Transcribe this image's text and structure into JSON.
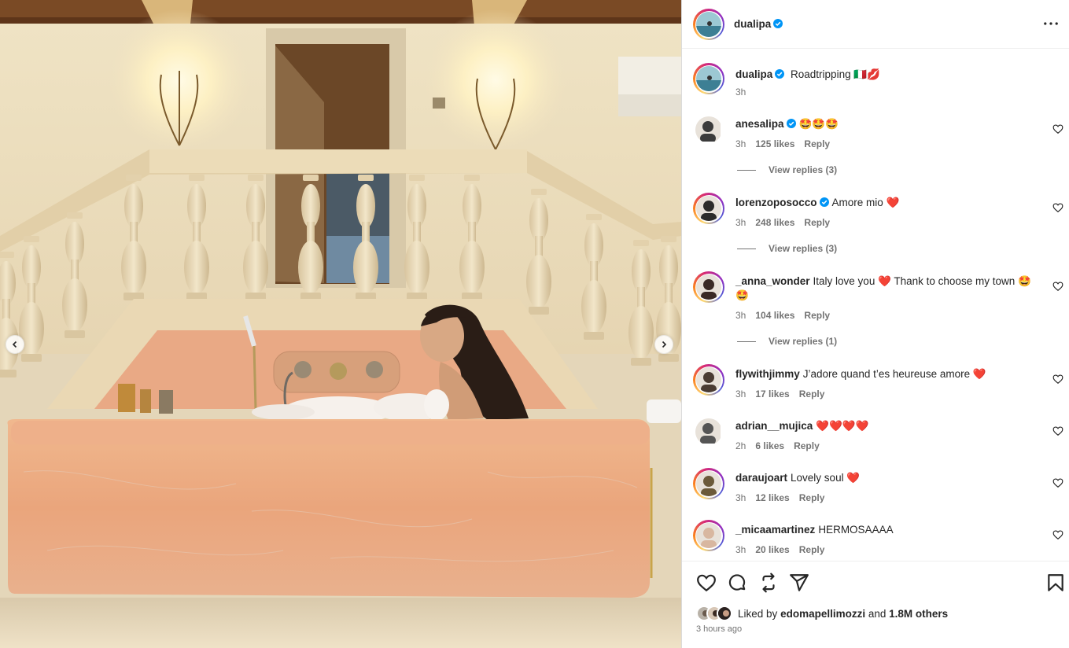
{
  "post": {
    "author": "dualipa",
    "caption_text": "Roadtripping",
    "caption_emoji": "🇮🇹💋",
    "caption_time": "3h",
    "more_icon": "more-horizontal-icon",
    "carousel": {
      "prev_icon": "chevron-left-icon",
      "next_icon": "chevron-right-icon"
    }
  },
  "comments": [
    {
      "user": "anesalipa",
      "verified": true,
      "text": "🤩🤩🤩",
      "time": "3h",
      "likes": "125 likes",
      "reply": "Reply",
      "view_replies": "View replies (3)"
    },
    {
      "user": "lorenzoposocco",
      "verified": true,
      "text": "Amore mio ❤️",
      "time": "3h",
      "likes": "248 likes",
      "reply": "Reply",
      "view_replies": "View replies (3)"
    },
    {
      "user": "_anna_wonder",
      "verified": false,
      "text": "Italy love you ❤️ Thank to choose my town 🤩 🤩",
      "time": "3h",
      "likes": "104 likes",
      "reply": "Reply",
      "view_replies": "View replies (1)"
    },
    {
      "user": "flywithjimmy",
      "verified": false,
      "text": "J’adore quand t’es heureuse amore ❤️",
      "time": "3h",
      "likes": "17 likes",
      "reply": "Reply"
    },
    {
      "user": "adrian__mujica",
      "verified": false,
      "text": "❤️❤️❤️❤️",
      "time": "2h",
      "likes": "6 likes",
      "reply": "Reply"
    },
    {
      "user": "daraujoart",
      "verified": false,
      "text": "Lovely soul ❤️",
      "time": "3h",
      "likes": "12 likes",
      "reply": "Reply"
    },
    {
      "user": "_micaamartinez",
      "verified": false,
      "text": "HERMOSAAAA",
      "time": "3h",
      "likes": "20 likes",
      "reply": "Reply"
    }
  ],
  "actions": {
    "like_icon": "heart-icon",
    "comment_icon": "comment-icon",
    "share_icon": "share-icon",
    "repost_icon": "repost-icon",
    "save_icon": "bookmark-icon"
  },
  "likes": {
    "prefix": "Liked by",
    "liker": "edomapellimozzi",
    "and": "and",
    "others": "1.8M others"
  },
  "posted": "3 hours ago",
  "colors": {
    "verified": "#0095f6",
    "heart_red": "#ed4956",
    "muted": "#737373"
  }
}
